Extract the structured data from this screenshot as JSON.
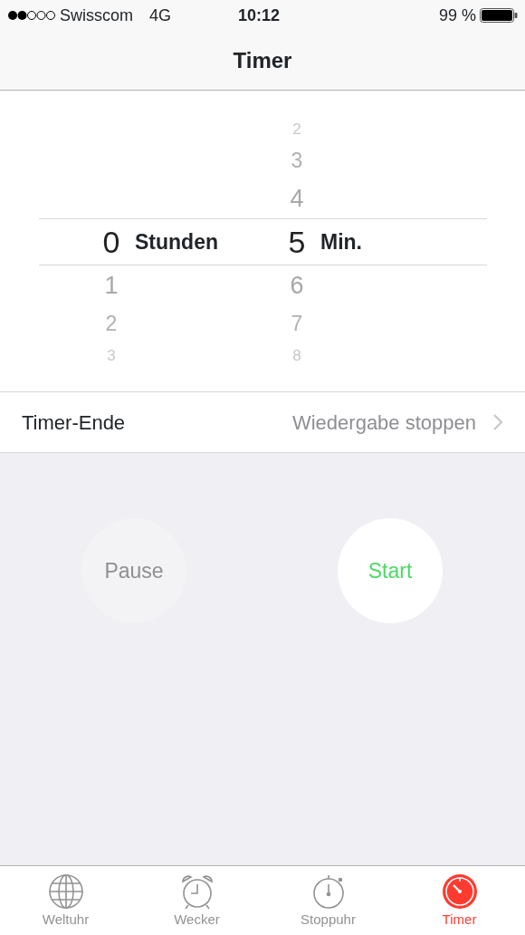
{
  "status_bar": {
    "carrier": "Swisscom",
    "network": "4G",
    "time": "10:12",
    "battery": "99 %"
  },
  "nav": {
    "title": "Timer"
  },
  "picker": {
    "columns": [
      {
        "unit": "Stunden",
        "selected": "0",
        "below": [
          "1",
          "2",
          "3"
        ]
      },
      {
        "unit": "Min.",
        "above": [
          "2",
          "3",
          "4"
        ],
        "selected": "5",
        "below": [
          "6",
          "7",
          "8"
        ]
      }
    ]
  },
  "setting": {
    "label": "Timer-Ende",
    "value": "Wiedergabe stoppen"
  },
  "buttons": [
    {
      "label": "Pause",
      "kind": "pause",
      "disabled": true
    },
    {
      "label": "Start",
      "kind": "start",
      "disabled": false
    }
  ],
  "tabs": [
    {
      "label": "Weltuhr",
      "kind": "globe",
      "selected": false
    },
    {
      "label": "Wecker",
      "kind": "alarm",
      "selected": false
    },
    {
      "label": "Stoppuhr",
      "kind": "stopwatch",
      "selected": false
    },
    {
      "label": "Timer",
      "kind": "timer",
      "selected": true
    }
  ]
}
